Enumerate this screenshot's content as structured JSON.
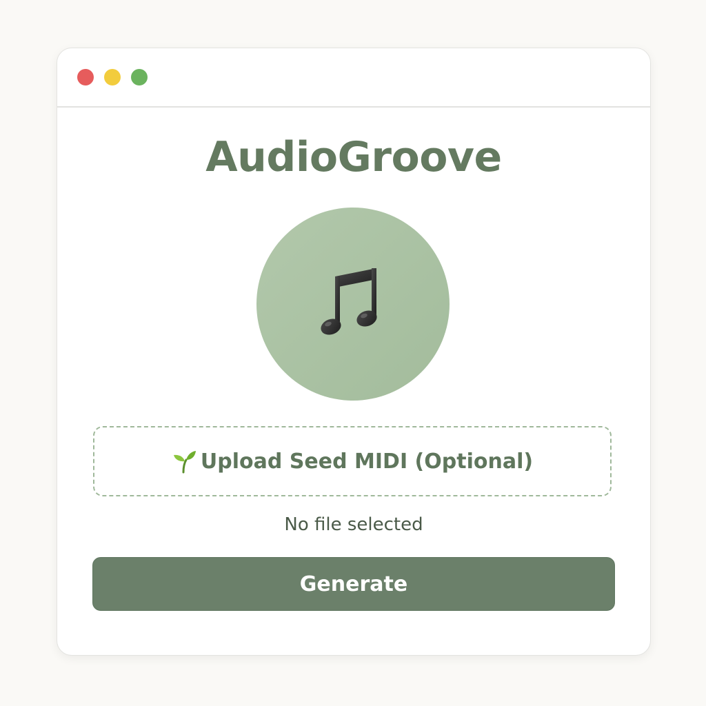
{
  "window": {
    "controls": {
      "close_color": "#e65c5c",
      "minimize_color": "#f2cc3d",
      "maximize_color": "#6bb35e"
    }
  },
  "app": {
    "title": "AudioGroove",
    "title_color": "#647a60",
    "logo_icon": "music-note-icon",
    "logo_bg_color": "#b2c8ab"
  },
  "upload": {
    "icon": "sprout-icon",
    "label": "Upload Seed MIDI (Optional)",
    "label_color": "#5f765c",
    "file_status": "No file selected"
  },
  "actions": {
    "generate_label": "Generate",
    "generate_color": "#6b806a"
  }
}
